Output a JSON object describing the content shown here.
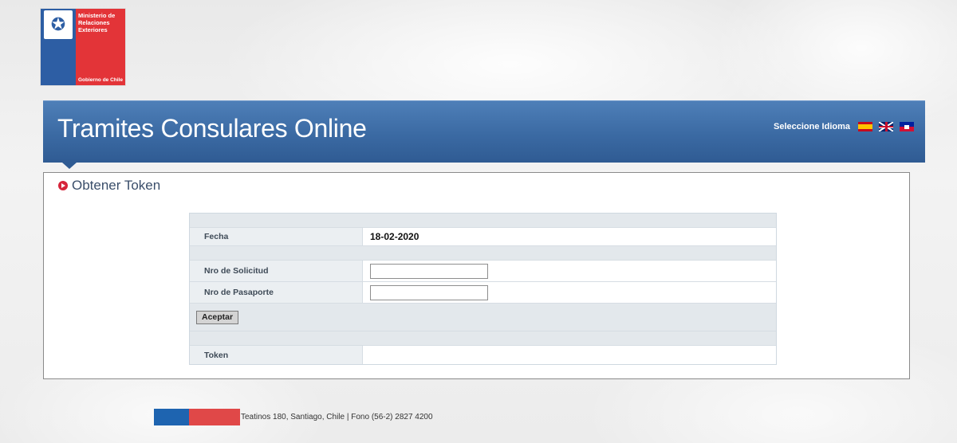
{
  "logo": {
    "ministry": "Ministerio de\nRelaciones\nExteriores",
    "government": "Gobierno de Chile"
  },
  "header": {
    "title": "Tramites Consulares Online",
    "language_label": "Seleccione Idioma"
  },
  "section": {
    "title": "Obtener Token"
  },
  "form": {
    "fecha_label": "Fecha",
    "fecha_value": "18-02-2020",
    "solicitud_label": "Nro de Solicitud",
    "solicitud_value": "",
    "pasaporte_label": "Nro de Pasaporte",
    "pasaporte_value": "",
    "submit_label": "Aceptar",
    "token_label": "Token",
    "token_value": ""
  },
  "footer": {
    "text": "Teatinos 180, Santiago, Chile | Fono (56-2) 2827 4200"
  },
  "colors": {
    "banner": "#3b6aa3",
    "logo_blue": "#2d5ea4",
    "logo_red": "#e33438",
    "accent_red": "#d6243a"
  }
}
